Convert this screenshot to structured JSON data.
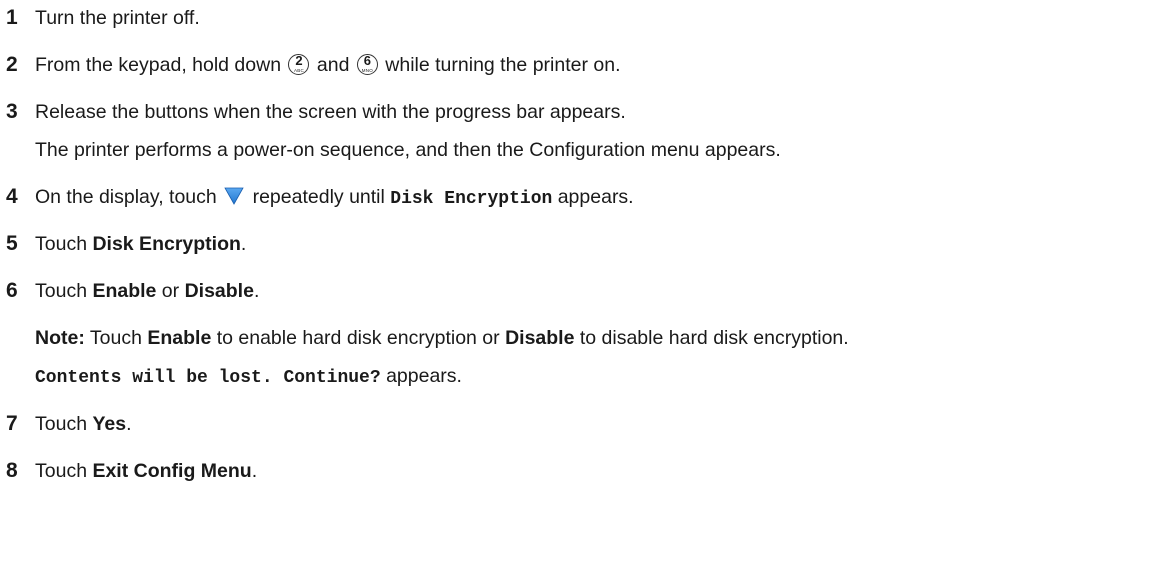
{
  "steps": [
    {
      "number": "1",
      "parts": [
        {
          "type": "text",
          "text": "Turn the printer off."
        }
      ]
    },
    {
      "number": "2",
      "parts": [
        {
          "type": "text",
          "text": "From the keypad, hold down "
        },
        {
          "type": "key",
          "digit": "2",
          "letters": "ABC"
        },
        {
          "type": "text",
          "text": " and "
        },
        {
          "type": "key",
          "digit": "6",
          "letters": "MNO"
        },
        {
          "type": "text",
          "text": " while turning the printer on."
        }
      ]
    },
    {
      "number": "3",
      "parts": [
        {
          "type": "text",
          "text": "Release the buttons when the screen with the progress bar appears."
        }
      ],
      "continuation": [
        [
          {
            "type": "text",
            "text": "The printer performs a power-on sequence, and then the Configuration menu appears."
          }
        ]
      ]
    },
    {
      "number": "4",
      "parts": [
        {
          "type": "text",
          "text": "On the display, touch "
        },
        {
          "type": "icon",
          "icon": "down-arrow-icon"
        },
        {
          "type": "text",
          "text": " repeatedly until "
        },
        {
          "type": "mono",
          "text": "Disk Encryption"
        },
        {
          "type": "text",
          "text": " appears."
        }
      ]
    },
    {
      "number": "5",
      "parts": [
        {
          "type": "text",
          "text": "Touch "
        },
        {
          "type": "bold",
          "text": "Disk Encryption"
        },
        {
          "type": "text",
          "text": "."
        }
      ]
    },
    {
      "number": "6",
      "parts": [
        {
          "type": "text",
          "text": "Touch "
        },
        {
          "type": "bold",
          "text": "Enable"
        },
        {
          "type": "text",
          "text": " or "
        },
        {
          "type": "bold",
          "text": "Disable"
        },
        {
          "type": "text",
          "text": "."
        }
      ],
      "continuation": [
        [
          {
            "type": "bold",
            "text": "Note:"
          },
          {
            "type": "text",
            "text": " Touch "
          },
          {
            "type": "bold",
            "text": "Enable"
          },
          {
            "type": "text",
            "text": " to enable hard disk encryption or "
          },
          {
            "type": "bold",
            "text": "Disable"
          },
          {
            "type": "text",
            "text": " to disable hard disk encryption."
          }
        ],
        [
          {
            "type": "mono",
            "text": "Contents will be lost. Continue?"
          },
          {
            "type": "text",
            "text": " appears."
          }
        ]
      ]
    },
    {
      "number": "7",
      "parts": [
        {
          "type": "text",
          "text": "Touch "
        },
        {
          "type": "bold",
          "text": "Yes"
        },
        {
          "type": "text",
          "text": "."
        }
      ]
    },
    {
      "number": "8",
      "parts": [
        {
          "type": "text",
          "text": "Touch "
        },
        {
          "type": "bold",
          "text": "Exit Config Menu"
        },
        {
          "type": "text",
          "text": "."
        }
      ]
    }
  ],
  "colors": {
    "text": "#1a1a1a",
    "arrow_icon": "#2277d0"
  }
}
